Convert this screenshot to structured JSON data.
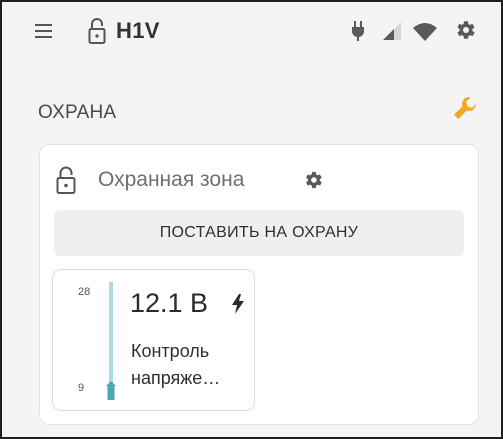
{
  "header": {
    "title": "H1V",
    "icons": [
      "menu-icon",
      "lock-icon",
      "plug-icon",
      "signal-icon",
      "wifi-icon",
      "gear-icon"
    ]
  },
  "section": {
    "title": "ОХРАНА",
    "action_icon": "wrench-icon",
    "accent_color": "#f5a623"
  },
  "zone": {
    "title": "Охранная зона",
    "arm_button_label": "ПОСТАВИТЬ НА ОХРАНУ",
    "sensor": {
      "scale_max": "28",
      "scale_min": "9",
      "value": "12.1 В",
      "value_number": 12.1,
      "label_line1": "Контроль",
      "label_line2": "напряже…",
      "gauge_color": "#a9dde3"
    }
  }
}
